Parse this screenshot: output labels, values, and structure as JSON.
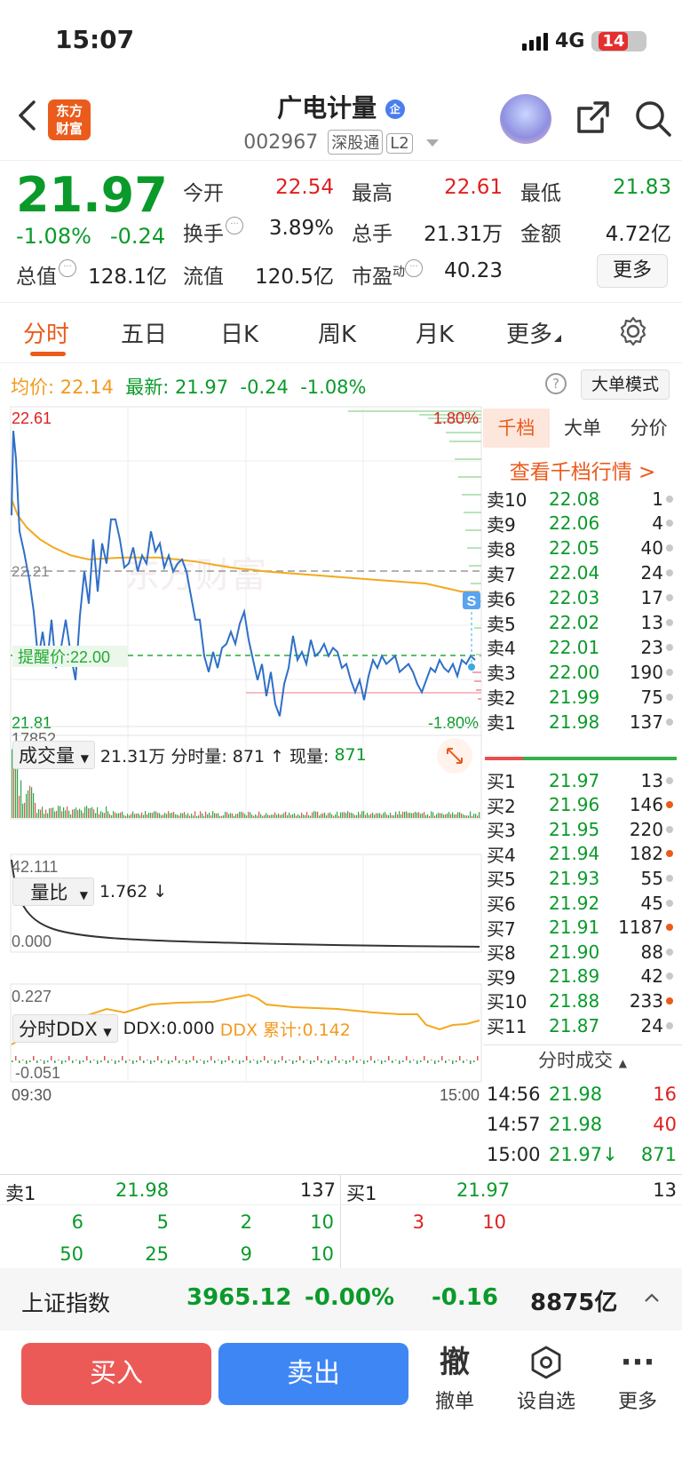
{
  "status": {
    "time": "15:07",
    "network": "4G",
    "battery": "14"
  },
  "header": {
    "logo_text": "东方财富",
    "name": "广电计量",
    "badge": "企",
    "code": "002967",
    "tags": [
      "深股通",
      "L2"
    ]
  },
  "quote": {
    "price": "21.97",
    "pct": "-1.08%",
    "change": "-0.24",
    "fields": [
      {
        "label": "今开",
        "value": "22.54",
        "color": "red"
      },
      {
        "label": "最高",
        "value": "22.61",
        "color": "red"
      },
      {
        "label": "最低",
        "value": "21.83",
        "color": "green"
      },
      {
        "label": "换手",
        "value": "3.89%",
        "color": "black"
      },
      {
        "label": "总手",
        "value": "21.31万",
        "color": "black"
      },
      {
        "label": "金额",
        "value": "4.72亿",
        "color": "black"
      },
      {
        "label": "总值",
        "value": "128.1亿",
        "color": "black"
      },
      {
        "label": "流值",
        "value": "120.5亿",
        "color": "black"
      },
      {
        "label": "市盈",
        "value": "40.23",
        "color": "black"
      }
    ],
    "pe_sup": "动",
    "more_label": "更多"
  },
  "tabs": [
    "分时",
    "五日",
    "日K",
    "周K",
    "月K",
    "更多"
  ],
  "avg_line": {
    "avg_label": "均价:",
    "avg": "22.14",
    "latest_label": "最新:",
    "latest": "21.97",
    "chg": "-0.24",
    "pct": "-1.08%"
  },
  "big_order_label": "大单模式",
  "chart": {
    "price_high": "22.61",
    "price_low": "21.81",
    "pct_high": "1.80%",
    "pct_low": "-1.80%",
    "ref_price": "22.21",
    "alert_label": "提醒价:22.00",
    "s_marker": "S",
    "volume_title": "成交量",
    "volume_info": "21.31万 分时量: 871 ↑ 现量:",
    "volume_now": "871",
    "volume_max": "17852",
    "ratio_title": "量比",
    "ratio_value": "1.762 ↓",
    "ratio_max": "42.111",
    "ratio_min": "0.000",
    "ddx_title": "分时DDX",
    "ddx_value": "DDX:0.000",
    "ddx_sum": "DDX 累计:0.142",
    "ddx_max": "0.227",
    "ddx_min": "-0.051",
    "time_start": "09:30",
    "time_end": "15:00"
  },
  "orderbook": {
    "tabs": [
      "千档",
      "大单",
      "分价"
    ],
    "link": "查看千档行情 >",
    "asks": [
      {
        "label": "卖10",
        "price": "22.08",
        "vol": "1",
        "dot": "gray"
      },
      {
        "label": "卖9",
        "price": "22.06",
        "vol": "4",
        "dot": "gray"
      },
      {
        "label": "卖8",
        "price": "22.05",
        "vol": "40",
        "dot": "gray"
      },
      {
        "label": "卖7",
        "price": "22.04",
        "vol": "24",
        "dot": "gray"
      },
      {
        "label": "卖6",
        "price": "22.03",
        "vol": "17",
        "dot": "gray"
      },
      {
        "label": "卖5",
        "price": "22.02",
        "vol": "13",
        "dot": "gray"
      },
      {
        "label": "卖4",
        "price": "22.01",
        "vol": "23",
        "dot": "gray"
      },
      {
        "label": "卖3",
        "price": "22.00",
        "vol": "190",
        "dot": "gray"
      },
      {
        "label": "卖2",
        "price": "21.99",
        "vol": "75",
        "dot": "gray"
      },
      {
        "label": "卖1",
        "price": "21.98",
        "vol": "137",
        "dot": "gray"
      }
    ],
    "bids": [
      {
        "label": "买1",
        "price": "21.97",
        "vol": "13",
        "dot": "gray"
      },
      {
        "label": "买2",
        "price": "21.96",
        "vol": "146",
        "dot": "orange"
      },
      {
        "label": "买3",
        "price": "21.95",
        "vol": "220",
        "dot": "gray"
      },
      {
        "label": "买4",
        "price": "21.94",
        "vol": "182",
        "dot": "orange"
      },
      {
        "label": "买5",
        "price": "21.93",
        "vol": "55",
        "dot": "gray"
      },
      {
        "label": "买6",
        "price": "21.92",
        "vol": "45",
        "dot": "gray"
      },
      {
        "label": "买7",
        "price": "21.91",
        "vol": "1187",
        "dot": "orange"
      },
      {
        "label": "买8",
        "price": "21.90",
        "vol": "88",
        "dot": "gray"
      },
      {
        "label": "买9",
        "price": "21.89",
        "vol": "42",
        "dot": "gray"
      },
      {
        "label": "买10",
        "price": "21.88",
        "vol": "233",
        "dot": "orange"
      },
      {
        "label": "买11",
        "price": "21.87",
        "vol": "24",
        "dot": "gray"
      }
    ],
    "trades_title": "分时成交",
    "trades": [
      {
        "time": "14:56",
        "price": "21.98",
        "vol": "16",
        "color": "red"
      },
      {
        "time": "14:57",
        "price": "21.98",
        "vol": "40",
        "color": "red"
      },
      {
        "time": "15:00",
        "price": "21.97↓",
        "vol": "871",
        "color": "green"
      }
    ]
  },
  "bottom_book": {
    "left_label": "卖1",
    "left_price": "21.98",
    "left_vol": "137",
    "right_label": "买1",
    "right_price": "21.97",
    "right_vol": "13",
    "left_row1": [
      "6",
      "5",
      "2",
      "10"
    ],
    "left_row2": [
      "50",
      "25",
      "9",
      "10"
    ],
    "right_row1": [
      "3",
      "10"
    ]
  },
  "index_bar": {
    "name": "上证指数",
    "value": "3965.12",
    "pct": "-0.00%",
    "chg": "-0.16",
    "amount": "8875亿"
  },
  "actions": {
    "buy": "买入",
    "sell": "卖出",
    "cancel_icon": "撤",
    "cancel": "撤单",
    "watch": "设自选",
    "more": "更多"
  },
  "colors": {
    "up": "#e02020",
    "down": "#0a9a2a",
    "brand": "#ea5b1c",
    "avg": "#f3a91e",
    "price_line": "#2f6fc7"
  }
}
